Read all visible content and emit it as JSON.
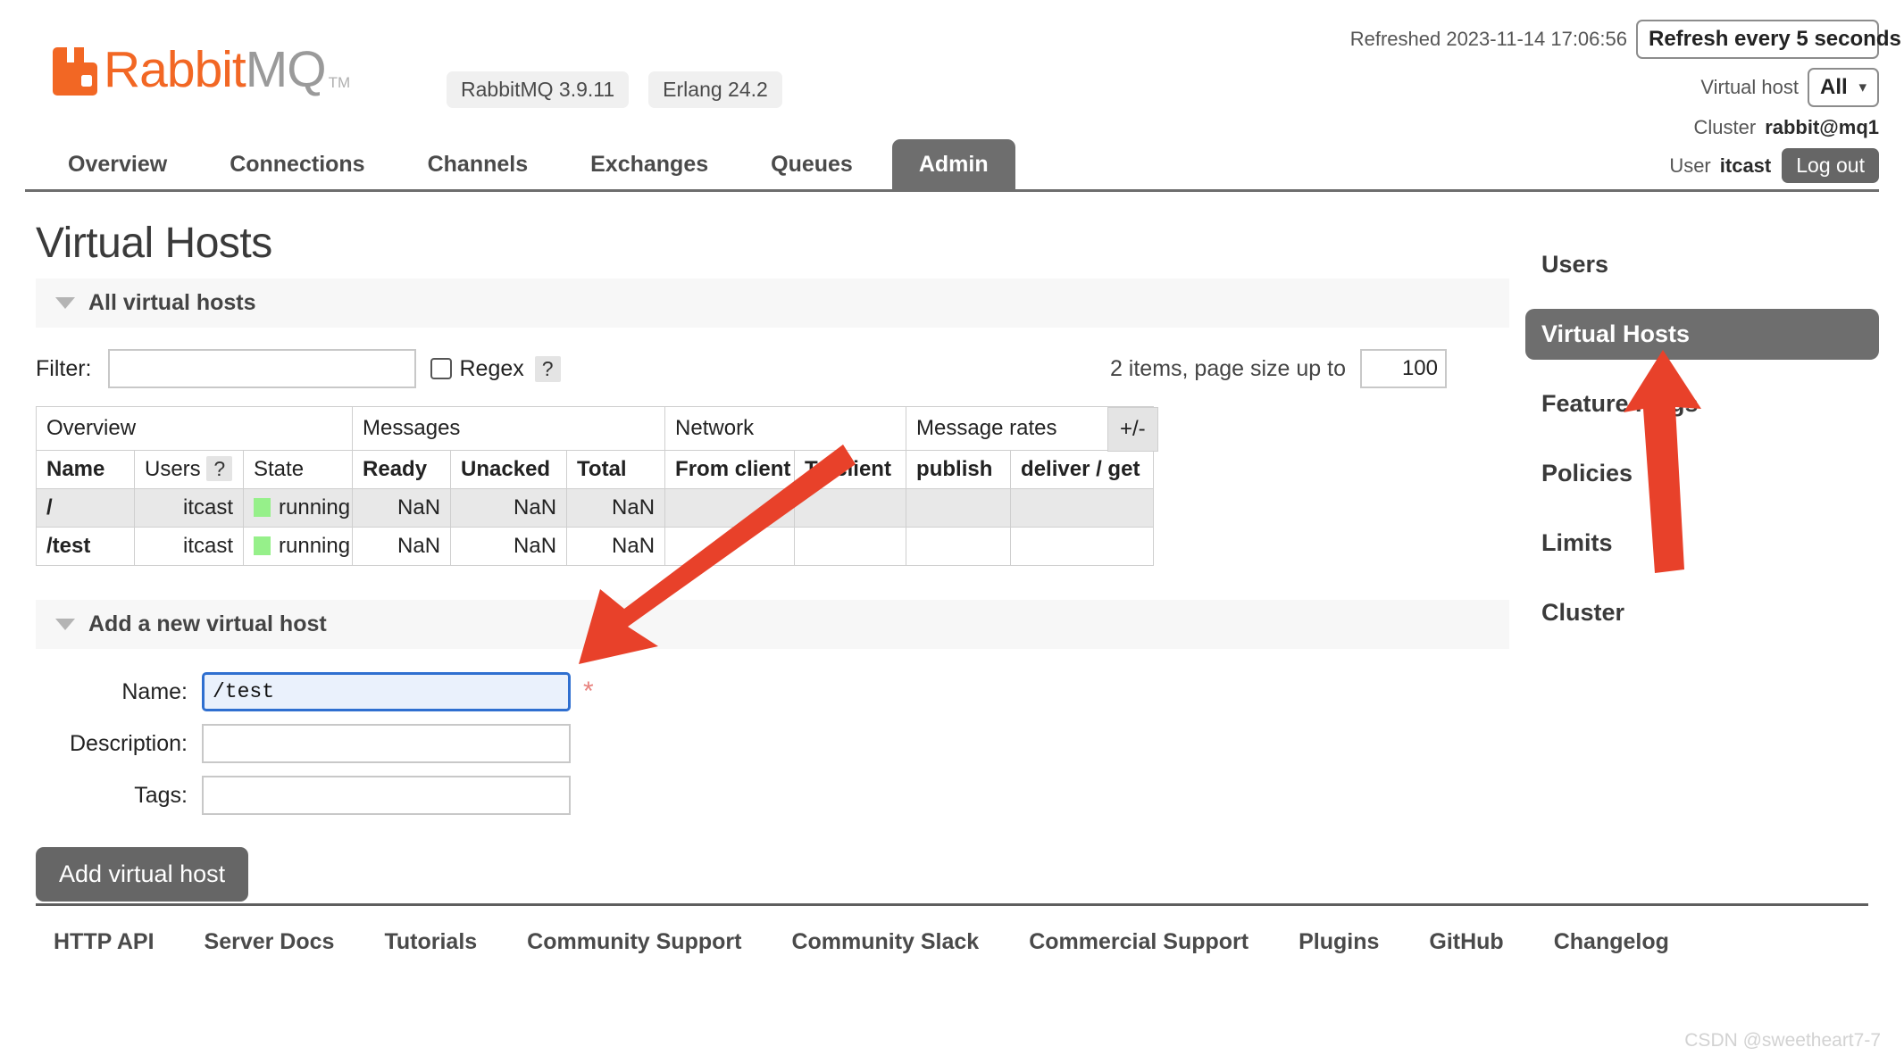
{
  "brand": {
    "name_part1": "Rabbit",
    "name_part2": "MQ",
    "tm": "TM",
    "logo_color": "#F26724",
    "mq_color": "#9a9a9a"
  },
  "header": {
    "badges": [
      "RabbitMQ 3.9.11",
      "Erlang 24.2"
    ],
    "refreshed_text": "Refreshed 2023-11-14 17:06:56",
    "refresh_select_value": "Refresh every 5 seconds",
    "vhost_label": "Virtual host",
    "vhost_select_value": "All",
    "cluster_label": "Cluster",
    "cluster_value": "rabbit@mq1",
    "user_label": "User",
    "user_value": "itcast",
    "logout_label": "Log out"
  },
  "nav": {
    "tabs": [
      {
        "label": "Overview",
        "active": false
      },
      {
        "label": "Connections",
        "active": false
      },
      {
        "label": "Channels",
        "active": false
      },
      {
        "label": "Exchanges",
        "active": false
      },
      {
        "label": "Queues",
        "active": false
      },
      {
        "label": "Admin",
        "active": true
      }
    ]
  },
  "main": {
    "page_title": "Virtual Hosts",
    "all_vhosts_heading": "All virtual hosts",
    "filter_label": "Filter:",
    "filter_value": "",
    "filter_placeholder": "",
    "regex_label": "Regex",
    "regex_help": "?",
    "regex_checked": false,
    "items_text": "2 items, page size up to",
    "page_size_value": "100",
    "plus_minus_label": "+/-"
  },
  "table": {
    "group_headers": [
      {
        "label": "Overview",
        "span": 3
      },
      {
        "label": "Messages",
        "span": 3
      },
      {
        "label": "Network",
        "span": 2
      },
      {
        "label": "Message rates",
        "span": 2
      }
    ],
    "column_headers": [
      {
        "label": "Name",
        "bold": true
      },
      {
        "label": "Users",
        "bold": false,
        "help": "?"
      },
      {
        "label": "State",
        "bold": false
      },
      {
        "label": "Ready",
        "bold": true
      },
      {
        "label": "Unacked",
        "bold": true
      },
      {
        "label": "Total",
        "bold": true
      },
      {
        "label": "From client",
        "bold": true
      },
      {
        "label": "To client",
        "bold": true
      },
      {
        "label": "publish",
        "bold": true
      },
      {
        "label": "deliver / get",
        "bold": true
      }
    ],
    "rows": [
      {
        "name": "/",
        "users": "itcast",
        "state": "running",
        "state_color": "#96F08A",
        "ready": "NaN",
        "unacked": "NaN",
        "total": "NaN",
        "from_client": "",
        "to_client": "",
        "publish": "",
        "deliver_get": ""
      },
      {
        "name": "/test",
        "users": "itcast",
        "state": "running",
        "state_color": "#96F08A",
        "ready": "NaN",
        "unacked": "NaN",
        "total": "NaN",
        "from_client": "",
        "to_client": "",
        "publish": "",
        "deliver_get": ""
      }
    ]
  },
  "add_form": {
    "heading": "Add a new virtual host",
    "name_label": "Name:",
    "name_value": "/test",
    "name_required_marker": "*",
    "description_label": "Description:",
    "description_value": "",
    "tags_label": "Tags:",
    "tags_value": "",
    "submit_label": "Add virtual host"
  },
  "sidebar": {
    "items": [
      {
        "label": "Users",
        "active": false
      },
      {
        "label": "Virtual Hosts",
        "active": true
      },
      {
        "label": "Feature Flags",
        "active": false
      },
      {
        "label": "Policies",
        "active": false
      },
      {
        "label": "Limits",
        "active": false
      },
      {
        "label": "Cluster",
        "active": false
      }
    ]
  },
  "footer": {
    "links": [
      "HTTP API",
      "Server Docs",
      "Tutorials",
      "Community Support",
      "Community Slack",
      "Commercial Support",
      "Plugins",
      "GitHub",
      "Changelog"
    ]
  },
  "watermark": {
    "text": "CSDN @sweetheart7-7"
  },
  "annotations": {
    "arrow_color": "#E8412A",
    "count": 2
  }
}
